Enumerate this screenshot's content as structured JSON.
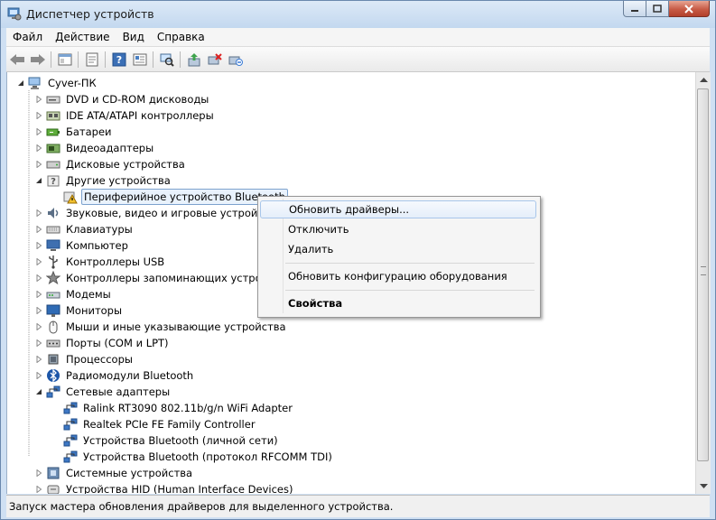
{
  "window": {
    "title": "Диспетчер устройств"
  },
  "menu": [
    "Файл",
    "Действие",
    "Вид",
    "Справка"
  ],
  "toolbar": [
    "back-arrow-icon",
    "forward-arrow-icon",
    "separator",
    "console-tree-icon",
    "separator",
    "properties-sheet-icon",
    "separator",
    "help-icon",
    "properties-icon",
    "separator",
    "scan-hardware-icon",
    "separator",
    "update-driver-icon",
    "disable-device-icon",
    "uninstall-device-icon"
  ],
  "tree": {
    "root": "Cyver-ПК",
    "categories": [
      {
        "label": "DVD и CD-ROM дисководы",
        "icon": "dvd-drive-icon",
        "expanded": false
      },
      {
        "label": "IDE ATA/ATAPI контроллеры",
        "icon": "ide-controller-icon",
        "expanded": false
      },
      {
        "label": "Батареи",
        "icon": "battery-icon",
        "expanded": false
      },
      {
        "label": "Видеоадаптеры",
        "icon": "display-adapter-icon",
        "expanded": false
      },
      {
        "label": "Дисковые устройства",
        "icon": "disk-drive-icon",
        "expanded": false
      },
      {
        "label": "Другие устройства",
        "icon": "other-devices-icon",
        "expanded": true,
        "children": [
          {
            "label": "Периферийное устройство Bluetooth",
            "icon": "warning-device-icon",
            "selected": true
          }
        ]
      },
      {
        "label": "Звуковые, видео и игровые устройства",
        "icon": "sound-icon",
        "expanded": false
      },
      {
        "label": "Клавиатуры",
        "icon": "keyboard-icon",
        "expanded": false
      },
      {
        "label": "Компьютер",
        "icon": "computer-icon",
        "expanded": false
      },
      {
        "label": "Контроллеры USB",
        "icon": "usb-icon",
        "expanded": false
      },
      {
        "label": "Контроллеры запоминающих устройств",
        "icon": "storage-controller-icon",
        "expanded": false
      },
      {
        "label": "Модемы",
        "icon": "modem-icon",
        "expanded": false
      },
      {
        "label": "Мониторы",
        "icon": "monitor-icon",
        "expanded": false
      },
      {
        "label": "Мыши и иные указывающие устройства",
        "icon": "mouse-icon",
        "expanded": false
      },
      {
        "label": "Порты (COM и LPT)",
        "icon": "port-icon",
        "expanded": false
      },
      {
        "label": "Процессоры",
        "icon": "processor-icon",
        "expanded": false
      },
      {
        "label": "Радиомодули Bluetooth",
        "icon": "bluetooth-icon",
        "expanded": false
      },
      {
        "label": "Сетевые адаптеры",
        "icon": "network-adapter-icon",
        "expanded": true,
        "children": [
          {
            "label": "Ralink RT3090 802.11b/g/n WiFi Adapter",
            "icon": "network-adapter-icon"
          },
          {
            "label": "Realtek PCIe FE Family Controller",
            "icon": "network-adapter-icon"
          },
          {
            "label": "Устройства Bluetooth (личной сети)",
            "icon": "network-adapter-icon"
          },
          {
            "label": "Устройства Bluetooth (протокол RFCOMM TDI)",
            "icon": "network-adapter-icon"
          }
        ]
      },
      {
        "label": "Системные устройства",
        "icon": "system-device-icon",
        "expanded": false
      },
      {
        "label": "Устройства HID (Human Interface Devices)",
        "icon": "hid-icon",
        "expanded": false
      }
    ]
  },
  "context_menu": {
    "items": [
      {
        "label": "Обновить драйверы...",
        "highlighted": true,
        "bold": false
      },
      {
        "label": "Отключить",
        "highlighted": false,
        "bold": false
      },
      {
        "label": "Удалить",
        "highlighted": false,
        "bold": false
      },
      {
        "type": "separator"
      },
      {
        "label": "Обновить конфигурацию оборудования",
        "highlighted": false,
        "bold": false
      },
      {
        "type": "separator"
      },
      {
        "label": "Свойства",
        "highlighted": false,
        "bold": true
      }
    ]
  },
  "status": "Запуск мастера обновления драйверов для выделенного устройства.",
  "colors": {
    "selection_fill": "#e9f2fc",
    "selection_border": "#7da2ce",
    "title_bar": "#c3d8ef",
    "close_button": "#c75a45"
  }
}
